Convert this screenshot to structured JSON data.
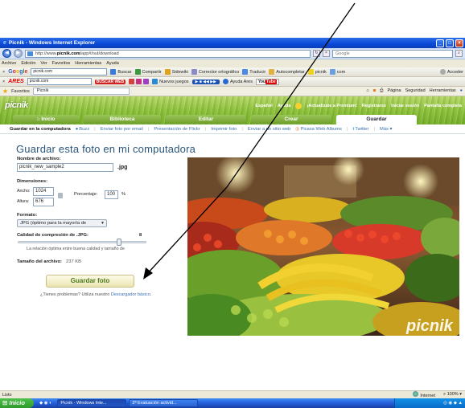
{
  "window": {
    "title": "Picnik - Windows Internet Explorer"
  },
  "address": {
    "url_prefix": "http://www.",
    "url_domain": "picnik.com",
    "url_path": "/app#/out/download",
    "search_placeholder": "Google"
  },
  "menu": [
    "Archivo",
    "Edición",
    "Ver",
    "Favoritos",
    "Herramientas",
    "Ayuda"
  ],
  "google_toolbar": {
    "search_value": "picnik.com",
    "items": [
      "Buscar",
      "Compartir",
      "Sidewiki",
      "Corrector ortográfico",
      "Traducir",
      "Autocompletar",
      "picnik",
      "com",
      "Acceder"
    ]
  },
  "ares_toolbar": {
    "brand": "ARES",
    "search_value": "picnik.com",
    "buscar": "BUSCAR WEB",
    "games": "Nuevos juegos",
    "ayuda": "Ayuda Ares",
    "youtube_you": "You",
    "youtube_tube": "Tube"
  },
  "favorites": {
    "label": "Favoritos",
    "tab": "Picnik",
    "right_items": [
      "Página",
      "Seguridad",
      "Herramientas"
    ]
  },
  "picnik": {
    "logo": "picnik",
    "top_links": [
      "Español",
      "Ayuda",
      "¡Actualízate a Premium!",
      "Registrarse",
      "Iniciar sesión",
      "Pantalla completa"
    ],
    "tabs": [
      "Inicio",
      "Biblioteca",
      "Editar",
      "Crear",
      "Guardar"
    ],
    "subnav": [
      "Guardar en la computadora",
      "Buzz",
      "Enviar foto por email",
      "Presentación de Flickr",
      "Imprimir foto",
      "Enviar a un sitio web",
      "Picasa Web Albums",
      "Twitter",
      "Más"
    ]
  },
  "form": {
    "title": "Guardar esta foto en mi computadora",
    "filename_label": "Nombre de archivo:",
    "filename_value": "picnik_new_sample2",
    "ext": ".jpg",
    "dims_label": "Dimensiones:",
    "width_label": "Ancho:",
    "width_value": "1024",
    "height_label": "Altura:",
    "height_value": "676",
    "percent_label": "Porcentaje:",
    "percent_value": "100",
    "percent_unit": "%",
    "format_label": "Formato:",
    "format_value": "JPG (óptimo para la mayoría de",
    "quality_label": "Calidad de compresión de .JPG:",
    "quality_value": "8",
    "quality_level": 0.8,
    "quality_hint": "La relación óptima entre buena calidad y tamaño de",
    "size_label": "Tamaño del archivo:",
    "size_value": "237 KB",
    "save_button": "Guardar foto",
    "help_text": "¿Tienes problemas? Utiliza nuestro ",
    "help_link": "Descargador básico."
  },
  "photo": {
    "watermark": "picnik"
  },
  "status": {
    "left": "Listo",
    "zone": "Internet",
    "zoom": "100%"
  },
  "taskbar": {
    "start": "Inicio",
    "tasks": [
      "Picnik - Windows Inte...",
      "2ª Evaluación activid..."
    ]
  },
  "colors": {
    "picnik_green": "#8fc23c",
    "title_blue": "#2a557a",
    "link_blue": "#3a6fb0",
    "annotation": "#000000"
  }
}
